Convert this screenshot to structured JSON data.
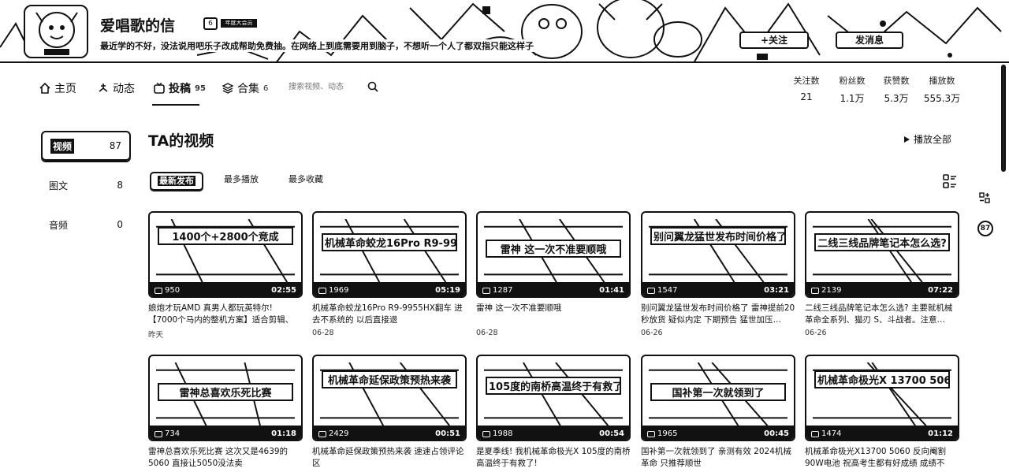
{
  "profile": {
    "name": "爱唱歌的信",
    "level": "6",
    "fan_badge": "年度大会员",
    "sign": "最近学的不好，没法说用吧乐子改成帮助免费抽。在网络上到底需要用到脑子，不想听一个人了都双指只能这样子"
  },
  "actions": {
    "follow": "+关注",
    "message": "发消息"
  },
  "nav": {
    "items": [
      {
        "label": "主页",
        "count": "",
        "icon": "home-icon"
      },
      {
        "label": "动态",
        "count": "",
        "icon": "dynamic-icon"
      },
      {
        "label": "投稿",
        "count": "95",
        "icon": "tv-icon"
      },
      {
        "label": "合集",
        "count": "6",
        "icon": "layers-icon"
      }
    ],
    "search_placeholder": "搜索视频、动态"
  },
  "stats": [
    {
      "label": "关注数",
      "value": "21"
    },
    {
      "label": "粉丝数",
      "value": "1.1万"
    },
    {
      "label": "获赞数",
      "value": "5.3万"
    },
    {
      "label": "播放数",
      "value": "555.3万"
    }
  ],
  "sidebar": [
    {
      "label": "视频",
      "count": "87"
    },
    {
      "label": "图文",
      "count": "8"
    },
    {
      "label": "音频",
      "count": "0"
    }
  ],
  "main": {
    "title": "TA的视频",
    "play_all": "播放全部",
    "sort_tabs": [
      "最新发布",
      "最多播放",
      "最多收藏"
    ]
  },
  "videos": [
    {
      "cover": "1400个+2800个竞成",
      "plays": "950",
      "duration": "02:55",
      "title": "娘炮才玩AMD 真男人都玩英特尔! 【7000个马内的整机方案】适合剪辑、直…",
      "date": "昨天"
    },
    {
      "cover": "机械革命蛟龙16Pro R9-9955HX翻车",
      "plays": "1969",
      "duration": "05:19",
      "title": "机械革命蛟龙16Pro R9-9955HX翻车 进去不系统的 以后直接退",
      "date": "06-28"
    },
    {
      "cover": "雷神 这一次不准要顺哦",
      "plays": "1287",
      "duration": "01:41",
      "title": "雷神 这一次不准要顺哦",
      "date": "06-28"
    },
    {
      "cover": "别问翼龙猛世发布时间价格了",
      "plays": "1547",
      "duration": "03:21",
      "title": "别问翼龙猛世发布时间价格了 雷神提前20秒放货 疑似内定 下期预告 猛世加压…",
      "date": "06-26"
    },
    {
      "cover": "二线三线品牌笔记本怎么选?",
      "plays": "2139",
      "duration": "07:22",
      "title": "二线三线品牌笔记本怎么选? 主要就机械革命全系列、猫刃 S、斗战者。注意…",
      "date": "06-26"
    },
    {
      "cover": "雷神总喜欢乐死比赛",
      "plays": "734",
      "duration": "01:18",
      "title": "雷神总喜欢乐死比赛 这次又是4639的5060 直接让5050没法卖",
      "date": ""
    },
    {
      "cover": "机械革命延保政策预热来袭",
      "plays": "2429",
      "duration": "00:51",
      "title": "机械革命延保政策预热来袭 速速占领评论区",
      "date": ""
    },
    {
      "cover": "105度的南桥高温终于有救了",
      "plays": "1988",
      "duration": "00:54",
      "title": "是夏季线! 我机械革命极光X 105度的南桥高温终于有救了!",
      "date": ""
    },
    {
      "cover": "国补第一次就领到了",
      "plays": "1965",
      "duration": "00:45",
      "title": "国补第一次就领到了 亲测有效 2024机械革命 只推荐顺世",
      "date": ""
    },
    {
      "cover": "机械革命极光X 13700 5060",
      "plays": "1474",
      "duration": "01:12",
      "title": "机械革命极光X13700 5060 反向阉割90W电池 祝高考生都有好成绩 成绩不好…",
      "date": ""
    }
  ]
}
